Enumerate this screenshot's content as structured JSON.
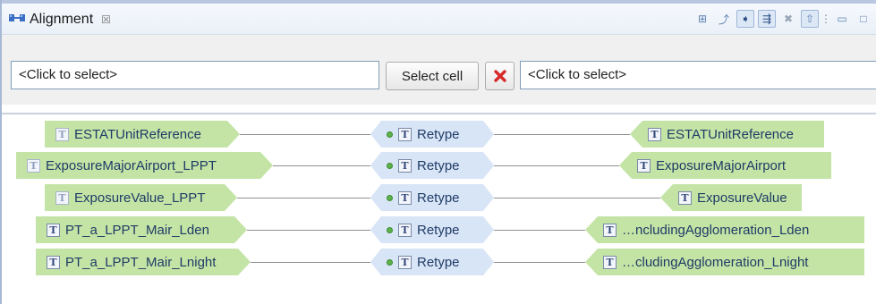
{
  "view": {
    "title": "Alignment",
    "close_glyph": "☒",
    "title_icon": "alignment-icon",
    "toolbar": [
      {
        "name": "hierarchy-layout-icon",
        "glyph": "⊞"
      },
      {
        "name": "export-icon",
        "glyph": "⤴"
      },
      {
        "name": "next-cell-icon",
        "glyph": "➧"
      },
      {
        "name": "filter-icon",
        "glyph": "⇶"
      },
      {
        "name": "delete-cell-icon",
        "glyph": "✖"
      },
      {
        "name": "up-icon",
        "glyph": "⇧"
      },
      {
        "name": "view-menu-icon",
        "glyph": "⋮"
      },
      {
        "name": "minimize-icon",
        "glyph": "▭"
      },
      {
        "name": "maximize-icon",
        "glyph": "□"
      }
    ]
  },
  "selector": {
    "source_value": "<Click to select>",
    "select_cell_label": "Select cell",
    "target_value": "<Click to select>"
  },
  "colors": {
    "source_node": "#c4e4a6",
    "function_node": "#d8e5f7",
    "target_node": "#c4e4a6",
    "clear_button_red": "#d62a2a"
  },
  "cells": [
    {
      "source": "ESTATUnitReference",
      "function": "Retype",
      "target": "ESTATUnitReference"
    },
    {
      "source": "ExposureMajorAirport_LPPT",
      "function": "Retype",
      "target": "ExposureMajorAirport"
    },
    {
      "source": "ExposureValue_LPPT",
      "function": "Retype",
      "target": "ExposureValue"
    },
    {
      "source": "PT_a_LPPT_Mair_Lden",
      "function": "Retype",
      "target": "…ncludingAgglomeration_Lden"
    },
    {
      "source": "PT_a_LPPT_Mair_Lnight",
      "function": "Retype",
      "target": "…cludingAgglomeration_Lnight"
    }
  ],
  "type_icon_letter": "T"
}
